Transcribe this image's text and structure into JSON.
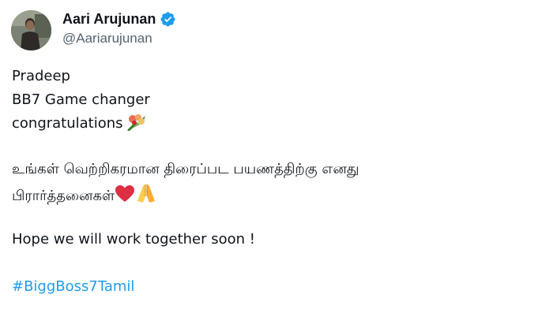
{
  "author": {
    "display_name": "Aari Arujunan",
    "handle": "@Aariarujunan",
    "verified": true,
    "verified_color": "#1d9bf0"
  },
  "tweet": {
    "lines": [
      "Pradeep",
      "BB7 Game changer",
      "congratulations",
      "உங்கள் வெற்றிகரமான திரைப்பட பயணத்திற்கு எனது",
      "பிரார்த்தனைகள்",
      "Hope we will work together soon !"
    ],
    "emojis": [
      "bouquet-icon",
      "red-heart-icon",
      "folded-hands-icon"
    ],
    "hashtag": "#BiggBoss7Tamil"
  },
  "colors": {
    "text": "#0f1419",
    "secondary": "#536471",
    "link": "#1d9bf0"
  }
}
